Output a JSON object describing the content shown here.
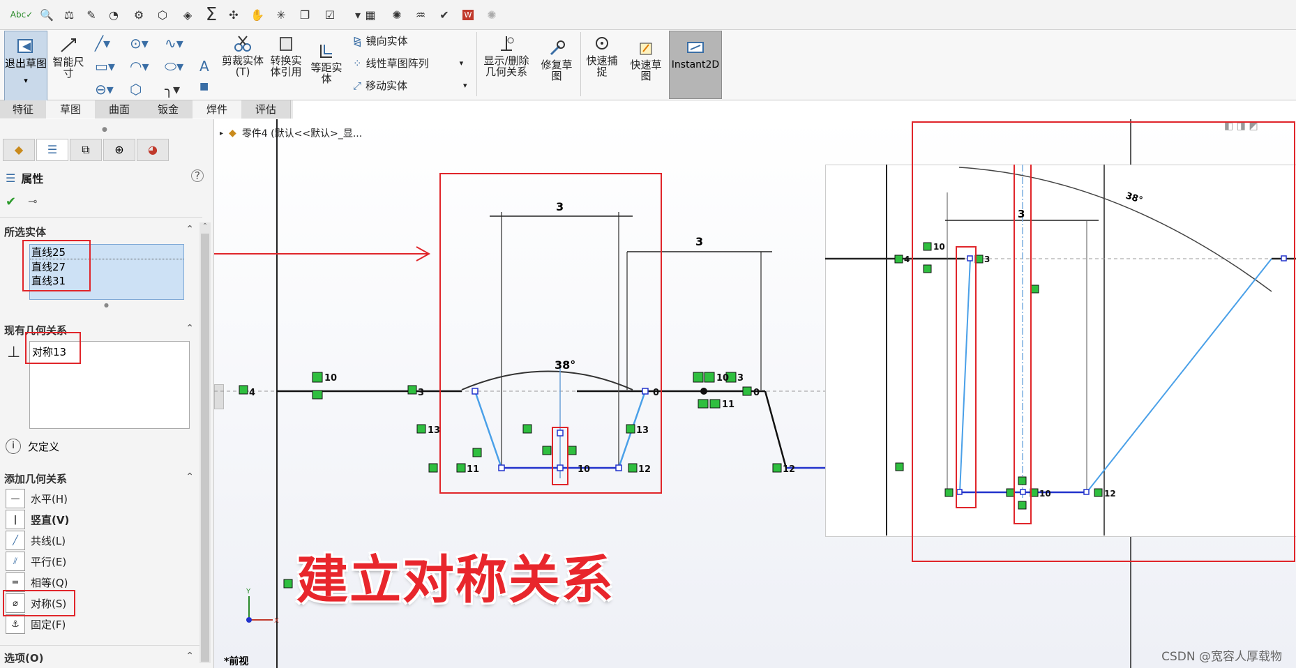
{
  "quickbar": {
    "icons": [
      "spelling-check-icon",
      "magnify-icon",
      "balance-icon",
      "sketch-icon",
      "gauge-icon",
      "gear-icon",
      "box-icon",
      "cube-icon",
      "sigma-icon",
      "axes-icon",
      "hand-icon",
      "star-icon",
      "copy-icon",
      "checklist-icon",
      "spreadsheet-icon",
      "palette-icon",
      "graph-icon",
      "check-circle-icon",
      "word-icon",
      "settings-icon"
    ]
  },
  "ribbon": {
    "exit_sketch": "退出草图",
    "smart_dimension": "智能尺寸",
    "trim_entities": "剪裁实体(T)",
    "convert_entities": "转换实体引用",
    "offset_entities": "等距实体",
    "mirror_entities": "镜向实体",
    "linear_pattern": "线性草图阵列",
    "move_entities": "移动实体",
    "display_delete_relations": "显示/删除几何关系",
    "repair_sketch": "修复草图",
    "quick_snaps": "快速捕捉",
    "rapid_sketch": "快速草图",
    "instant2d": "Instant2D"
  },
  "tabs": [
    "特征",
    "草图",
    "曲面",
    "钣金",
    "焊件",
    "评估"
  ],
  "tree": {
    "part_label": "零件4 (默认<<默认>_显..."
  },
  "panel": {
    "title": "属性",
    "selected_header": "所选实体",
    "selected_items": [
      "直线25",
      "直线27",
      "直线31"
    ],
    "existing_header": "现有几何关系",
    "existing_items": [
      "对称13"
    ],
    "status": "欠定义",
    "add_header": "添加几何关系",
    "add_items": [
      {
        "label": "水平(H)",
        "icon": "horizontal-icon",
        "bold": false
      },
      {
        "label": "竖直(V)",
        "icon": "vertical-icon",
        "bold": true
      },
      {
        "label": "共线(L)",
        "icon": "collinear-icon",
        "bold": false
      },
      {
        "label": "平行(E)",
        "icon": "parallel-icon",
        "bold": false
      },
      {
        "label": "相等(Q)",
        "icon": "equal-icon",
        "bold": false
      },
      {
        "label": "对称(S)",
        "icon": "symmetric-icon",
        "bold": false
      },
      {
        "label": "固定(F)",
        "icon": "fix-icon",
        "bold": false
      }
    ],
    "options_header": "选项(O)"
  },
  "canvas": {
    "dim_3a": "3",
    "dim_3b": "3",
    "angle_a": "38°",
    "angle_b": "38°",
    "dim_zoom": "3",
    "view_label": "*前视",
    "axis_y": "Y",
    "axis_x": "X",
    "labels": [
      "4",
      "10",
      "3",
      "13",
      "11",
      "10",
      "12",
      "13",
      "0",
      "10",
      "3",
      "11",
      "0",
      "12"
    ],
    "zoom_labels": [
      "4",
      "10",
      "3",
      "10",
      "12"
    ]
  },
  "overlay_title": "建立对称关系",
  "watermark": "CSDN @宽容人厚载物"
}
